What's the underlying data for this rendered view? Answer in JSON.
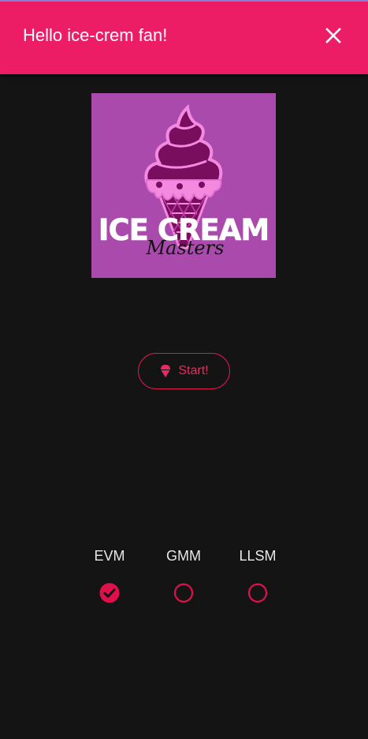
{
  "header": {
    "title": "Hello ice-crem fan!",
    "close_icon": "close-icon",
    "background_color": "#ec1d64"
  },
  "logo": {
    "title_text": "ICE CREAM",
    "subtitle_text": "Masters",
    "background_color": "#a94aac"
  },
  "start_button": {
    "label": "Start!",
    "icon": "ice-cream-icon",
    "accent_color": "#e01850"
  },
  "options": [
    {
      "label": "EVM",
      "selected": true
    },
    {
      "label": "GMM",
      "selected": false
    },
    {
      "label": "LLSM",
      "selected": false
    }
  ],
  "colors": {
    "background": "#141414",
    "accent": "#e0104a",
    "text": "#e8e8e8"
  }
}
